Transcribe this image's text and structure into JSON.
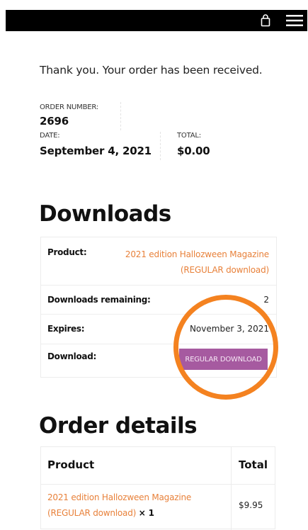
{
  "header": {
    "cart_icon": "shopping-bag-icon",
    "menu_icon": "hamburger-menu-icon"
  },
  "thank_you": "Thank you. Your order has been received.",
  "overview": {
    "order_number_label": "ORDER NUMBER:",
    "order_number": "2696",
    "date_label": "DATE:",
    "date": "September 4, 2021",
    "total_label": "TOTAL:",
    "total": "$0.00"
  },
  "downloads": {
    "heading": "Downloads",
    "product_label": "Product:",
    "product_name": "2021 edition Hallozween Magazine (REGULAR download)",
    "remaining_label": "Downloads remaining:",
    "remaining_value": "2",
    "expires_label": "Expires:",
    "expires_value": "November 3, 2021",
    "download_label": "Download:",
    "download_button": "REGULAR DOWNLOAD",
    "button_color": "#a65aa0",
    "highlight_color": "#f48220"
  },
  "order_details": {
    "heading": "Order details",
    "col_product": "Product",
    "col_total": "Total",
    "items": [
      {
        "name": "2021 edition Hallozween Magazine (REGULAR download)",
        "qty": "× 1",
        "total": "$9.95"
      }
    ],
    "link_color": "#e8813a"
  }
}
